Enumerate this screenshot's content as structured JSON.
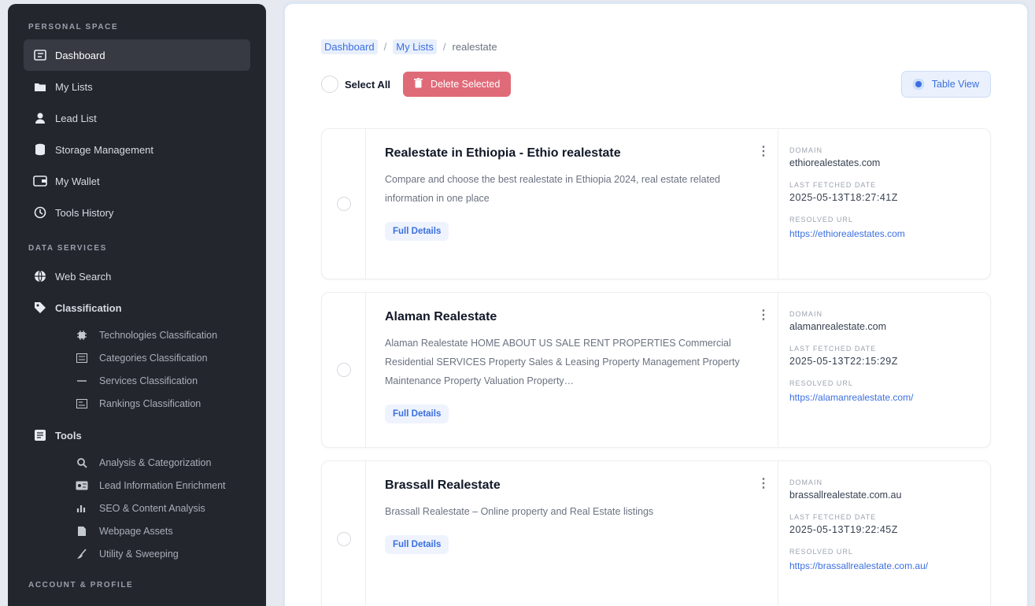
{
  "sidebar": {
    "section1": "PERSONAL SPACE",
    "items1": [
      {
        "label": "Dashboard",
        "icon": "dashboard-icon"
      },
      {
        "label": "My Lists",
        "icon": "folder-icon"
      },
      {
        "label": "Lead List",
        "icon": "user-icon"
      },
      {
        "label": "Storage Management",
        "icon": "database-icon"
      },
      {
        "label": "My Wallet",
        "icon": "wallet-icon"
      },
      {
        "label": "Tools History",
        "icon": "history-icon"
      }
    ],
    "section2": "DATA SERVICES",
    "web_search": "Web Search",
    "classification": "Classification",
    "classification_items": [
      "Technologies Classification",
      "Categories Classification",
      "Services Classification",
      "Rankings Classification"
    ],
    "tools": "Tools",
    "tools_items": [
      "Analysis & Categorization",
      "Lead Information Enrichment",
      "SEO & Content Analysis",
      "Webpage Assets",
      "Utility & Sweeping"
    ],
    "section3": "ACCOUNT & PROFILE"
  },
  "breadcrumb": {
    "item1": "Dashboard",
    "item2": "My Lists",
    "current": "realestate",
    "sep": "/"
  },
  "toolbar": {
    "select_all": "Select All",
    "delete_selected": "Delete Selected",
    "table_view": "Table View"
  },
  "meta_labels": {
    "domain": "DOMAIN",
    "last_fetched": "LAST FETCHED DATE",
    "resolved_url": "RESOLVED URL"
  },
  "full_details": "Full Details",
  "cards": [
    {
      "title": "Realestate in Ethiopia - Ethio realestate",
      "desc": "Compare and choose the best realestate in Ethiopia 2024, real estate related information in one place",
      "domain": "ethiorealestates.com",
      "date": "2025-05-13T18:27:41Z",
      "url": "https://ethiorealestates.com"
    },
    {
      "title": "Alaman Realestate",
      "desc": "Alaman Realestate HOME ABOUT US SALE RENT PROPERTIES Commercial Residential SERVICES Property Sales & Leasing Property Management Property Maintenance Property Valuation Property…",
      "domain": "alamanrealestate.com",
      "date": "2025-05-13T22:15:29Z",
      "url": "https://alamanrealestate.com/"
    },
    {
      "title": "Brassall Realestate",
      "desc": "Brassall Realestate – Online property and Real Estate listings",
      "domain": "brassallrealestate.com.au",
      "date": "2025-05-13T19:22:45Z",
      "url": "https://brassallrealestate.com.au/"
    }
  ],
  "colors": {
    "sidebar_bg": "#23262d",
    "accent": "#3b6fe0",
    "danger": "#e06b78"
  }
}
